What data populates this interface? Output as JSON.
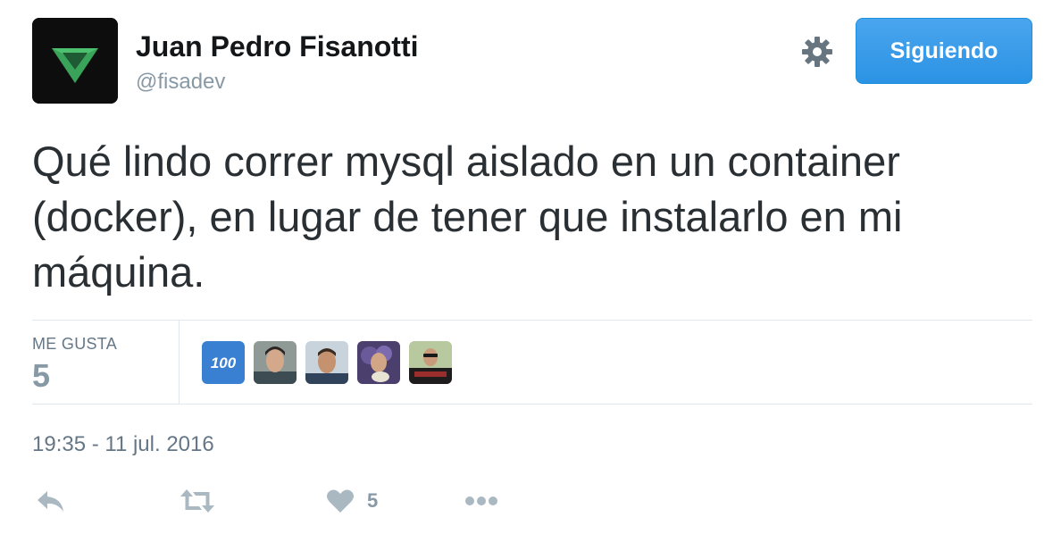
{
  "tweet": {
    "author": {
      "name": "Juan Pedro Fisanotti",
      "handle": "@fisadev"
    },
    "follow_label": "Siguiendo",
    "text": "Qué lindo correr mysql aislado en un container (docker), en lugar de tener que instalarlo en mi máquina.",
    "stats": {
      "likes_label": "ME GUSTA",
      "likes_count": "5",
      "likers": [
        {
          "name": "100-avatar",
          "label": "100"
        },
        {
          "name": "user-avatar-2"
        },
        {
          "name": "user-avatar-3"
        },
        {
          "name": "user-avatar-4"
        },
        {
          "name": "user-avatar-5"
        }
      ]
    },
    "timestamp": "19:35 - 11 jul. 2016",
    "actions": {
      "reply_icon": "reply-icon",
      "retweet_icon": "retweet-icon",
      "like_icon": "heart-icon",
      "like_count": "5",
      "more_icon": "more-icon"
    }
  },
  "colors": {
    "follow_button": "#2b93e4",
    "avatar_triangle": "#3aa35a",
    "text": "#292f33",
    "muted": "#8899a6"
  }
}
